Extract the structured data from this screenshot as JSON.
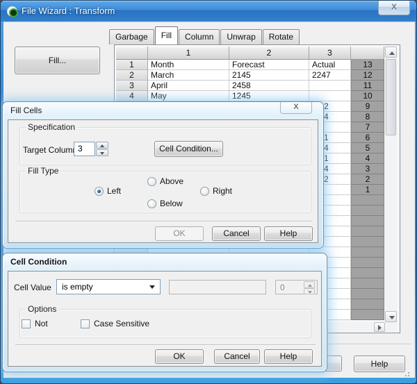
{
  "colors": {
    "titlebar_blue": "#3584d2",
    "glass_blue": "#cfe6f4",
    "body_gray": "#f0f0f0",
    "grid_index_gray": "#a2a2a2",
    "radio_selected_blue": "#1d4e7d"
  },
  "window": {
    "title": "File Wizard : Transform",
    "close_glyph": "X",
    "fill_button_label": "Fill...",
    "help_button_label": "Help",
    "tabs": [
      {
        "label": "Garbage",
        "active": false
      },
      {
        "label": "Fill",
        "active": true
      },
      {
        "label": "Column",
        "active": false
      },
      {
        "label": "Unwrap",
        "active": false
      },
      {
        "label": "Rotate",
        "active": false
      }
    ]
  },
  "table": {
    "col_headers": [
      "1",
      "2",
      "3"
    ],
    "rows": [
      {
        "num": "1",
        "c1": "Month",
        "c2": "Forecast",
        "c3": "Actual",
        "right": "13",
        "partial": false
      },
      {
        "num": "2",
        "c1": "March",
        "c2": "2145",
        "c3": "2247",
        "right": "12",
        "partial": false
      },
      {
        "num": "3",
        "c1": "April",
        "c2": "2458",
        "c3": "",
        "right": "11",
        "partial": false
      },
      {
        "num": "4",
        "c1": "May",
        "c2": "1245",
        "c3": "",
        "right": "10",
        "partial": false
      },
      {
        "num": "",
        "c1": "",
        "c2": "",
        "c3": "2",
        "right": "9",
        "partial": true
      },
      {
        "num": "",
        "c1": "",
        "c2": "",
        "c3": "4",
        "right": "8",
        "partial": true
      },
      {
        "num": "",
        "c1": "",
        "c2": "",
        "c3": "",
        "right": "7",
        "partial": false
      },
      {
        "num": "",
        "c1": "",
        "c2": "",
        "c3": "1",
        "right": "6",
        "partial": true
      },
      {
        "num": "",
        "c1": "",
        "c2": "",
        "c3": "4",
        "right": "5",
        "partial": true
      },
      {
        "num": "",
        "c1": "",
        "c2": "",
        "c3": "1",
        "right": "4",
        "partial": true
      },
      {
        "num": "",
        "c1": "",
        "c2": "",
        "c3": "4",
        "right": "3",
        "partial": true
      },
      {
        "num": "",
        "c1": "",
        "c2": "",
        "c3": "2",
        "right": "2",
        "partial": true
      },
      {
        "num": "",
        "c1": "",
        "c2": "",
        "c3": "",
        "right": "1",
        "partial": false
      }
    ],
    "filler_rows": 12
  },
  "fill_cells": {
    "title": "Fill Cells",
    "close_glyph": "X",
    "spec_group_label": "Specification",
    "target_column_label": "Target Column",
    "target_column_value": "3",
    "cell_condition_button_label": "Cell Condition...",
    "fill_type_group_label": "Fill Type",
    "radios": [
      {
        "label": "Left",
        "selected": true
      },
      {
        "label": "Above",
        "selected": false
      },
      {
        "label": "Below",
        "selected": false
      },
      {
        "label": "Right",
        "selected": false
      }
    ],
    "ok_label": "OK",
    "cancel_label": "Cancel",
    "help_label": "Help",
    "ok_disabled": true
  },
  "cell_condition": {
    "title": "Cell Condition",
    "cell_value_label": "Cell Value",
    "operator_selected": "is empty",
    "text_value": "",
    "number_value": "0",
    "options_group_label": "Options",
    "checkboxes": [
      {
        "label": "Not",
        "checked": false
      },
      {
        "label": "Case Sensitive",
        "checked": false
      }
    ],
    "ok_label": "OK",
    "cancel_label": "Cancel",
    "help_label": "Help"
  }
}
